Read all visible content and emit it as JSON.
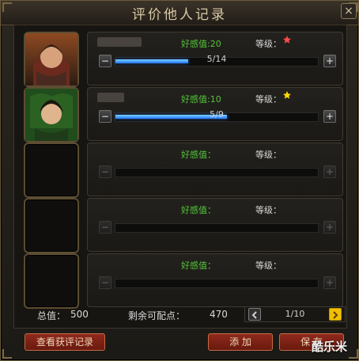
{
  "window": {
    "title": "评价他人记录",
    "close_label": "×"
  },
  "entries": [
    {
      "name_hidden": true,
      "favor_label": "好感值",
      "favor_value": ":20",
      "grade_label": "等级：",
      "star_color": "#ff4b4b",
      "progress_text": "5/14",
      "progress_ratio": 0.36,
      "minus": "−",
      "plus": "+"
    },
    {
      "name_hidden": true,
      "favor_label": "好感值",
      "favor_value": ":10",
      "grade_label": "等级：",
      "star_color": "#ffd800",
      "progress_text": "5/9",
      "progress_ratio": 0.55,
      "minus": "−",
      "plus": "+"
    },
    {
      "favor_label": "好感值：",
      "grade_label": "等级：",
      "minus": "−",
      "plus": "+"
    },
    {
      "favor_label": "好感值：",
      "grade_label": "等级：",
      "minus": "−",
      "plus": "+"
    },
    {
      "favor_label": "好感值：",
      "grade_label": "等级：",
      "minus": "−",
      "plus": "+"
    }
  ],
  "footer": {
    "total_label": "总值：",
    "total_value": "500",
    "remaining_label": "剩余可配点：",
    "remaining_value": "470",
    "page_text": "1/10"
  },
  "buttons": {
    "view_received": "查看获评记录",
    "add": "添 加",
    "save": "保 存"
  },
  "watermark": "酷乐米"
}
